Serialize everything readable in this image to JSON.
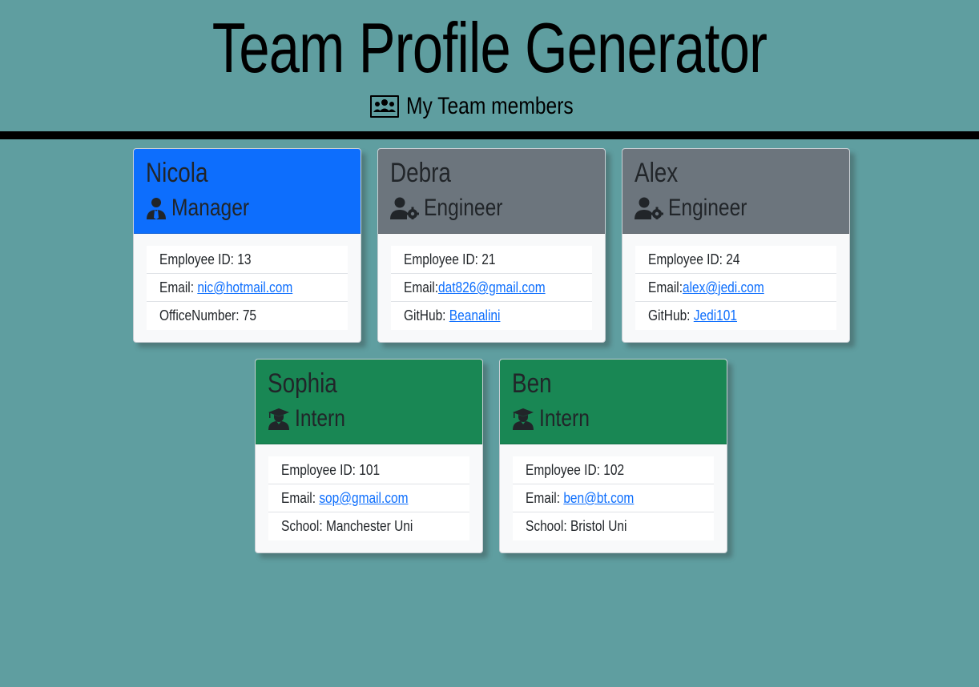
{
  "header": {
    "title": "Team Profile Generator",
    "subtitle": "My Team members",
    "subtitle_icon": "people-group-icon"
  },
  "team": [
    {
      "name": "Nicola",
      "role": "Manager",
      "role_icon": "user-tie-icon",
      "header_color": "#0d6efd",
      "id_label": "Employee ID: ",
      "id": "13",
      "email_label": "Email: ",
      "email": "nic@hotmail.com",
      "extra_label": "OfficeNumber: ",
      "extra_value": "75"
    },
    {
      "name": "Debra",
      "role": "Engineer",
      "role_icon": "user-gear-icon",
      "header_color": "#6c757d",
      "id_label": "Employee ID: ",
      "id": "21",
      "email_label": "Email:",
      "email": "dat826@gmail.com",
      "extra_label": "GitHub: ",
      "extra_value": "Beanalini"
    },
    {
      "name": "Alex",
      "role": "Engineer",
      "role_icon": "user-gear-icon",
      "header_color": "#6c757d",
      "id_label": "Employee ID: ",
      "id": "24",
      "email_label": "Email:",
      "email": "alex@jedi.com",
      "extra_label": "GitHub: ",
      "extra_value": "Jedi101"
    },
    {
      "name": "Sophia",
      "role": "Intern",
      "role_icon": "user-graduate-icon",
      "header_color": "#198754",
      "id_label": "Employee ID: ",
      "id": "101",
      "email_label": "Email: ",
      "email": "sop@gmail.com",
      "extra_label": "School: ",
      "extra_value": "Manchester Uni"
    },
    {
      "name": "Ben",
      "role": "Intern",
      "role_icon": "user-graduate-icon",
      "header_color": "#198754",
      "id_label": "Employee ID: ",
      "id": "102",
      "email_label": "Email: ",
      "email": "ben@bt.com",
      "extra_label": "School: ",
      "extra_value": "Bristol Uni"
    }
  ]
}
